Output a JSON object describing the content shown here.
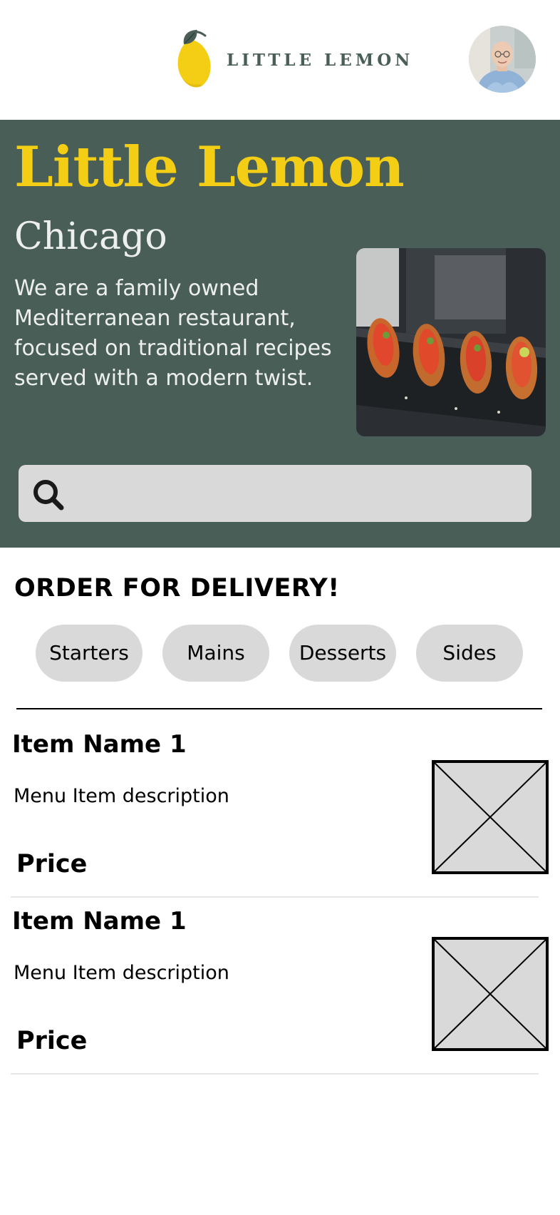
{
  "header": {
    "brand_name": "LITTLE LEMON",
    "logo_icon": "lemon-icon",
    "avatar_icon": "user-avatar"
  },
  "hero": {
    "title": "Little Lemon",
    "city": "Chicago",
    "description": "We are a family owned Mediterranean restaurant, focused on traditional recipes served with a modern twist.",
    "image_icon": "food-photo",
    "search": {
      "icon": "search-icon",
      "placeholder": ""
    }
  },
  "order": {
    "title": "ORDER FOR DELIVERY!",
    "categories": [
      {
        "label": "Starters"
      },
      {
        "label": "Mains"
      },
      {
        "label": "Desserts"
      },
      {
        "label": "Sides"
      }
    ]
  },
  "menu": {
    "items": [
      {
        "name": "Item Name 1",
        "description": "Menu Item description",
        "price": "Price",
        "image_icon": "image-placeholder-icon"
      },
      {
        "name": "Item Name 1",
        "description": "Menu Item description",
        "price": "Price",
        "image_icon": "image-placeholder-icon"
      }
    ]
  },
  "colors": {
    "primary_green": "#495E57",
    "primary_yellow": "#F4CE14",
    "light_text": "#EDEFEE",
    "pill_gray": "#D9D9D9",
    "text_dark": "#000000"
  }
}
